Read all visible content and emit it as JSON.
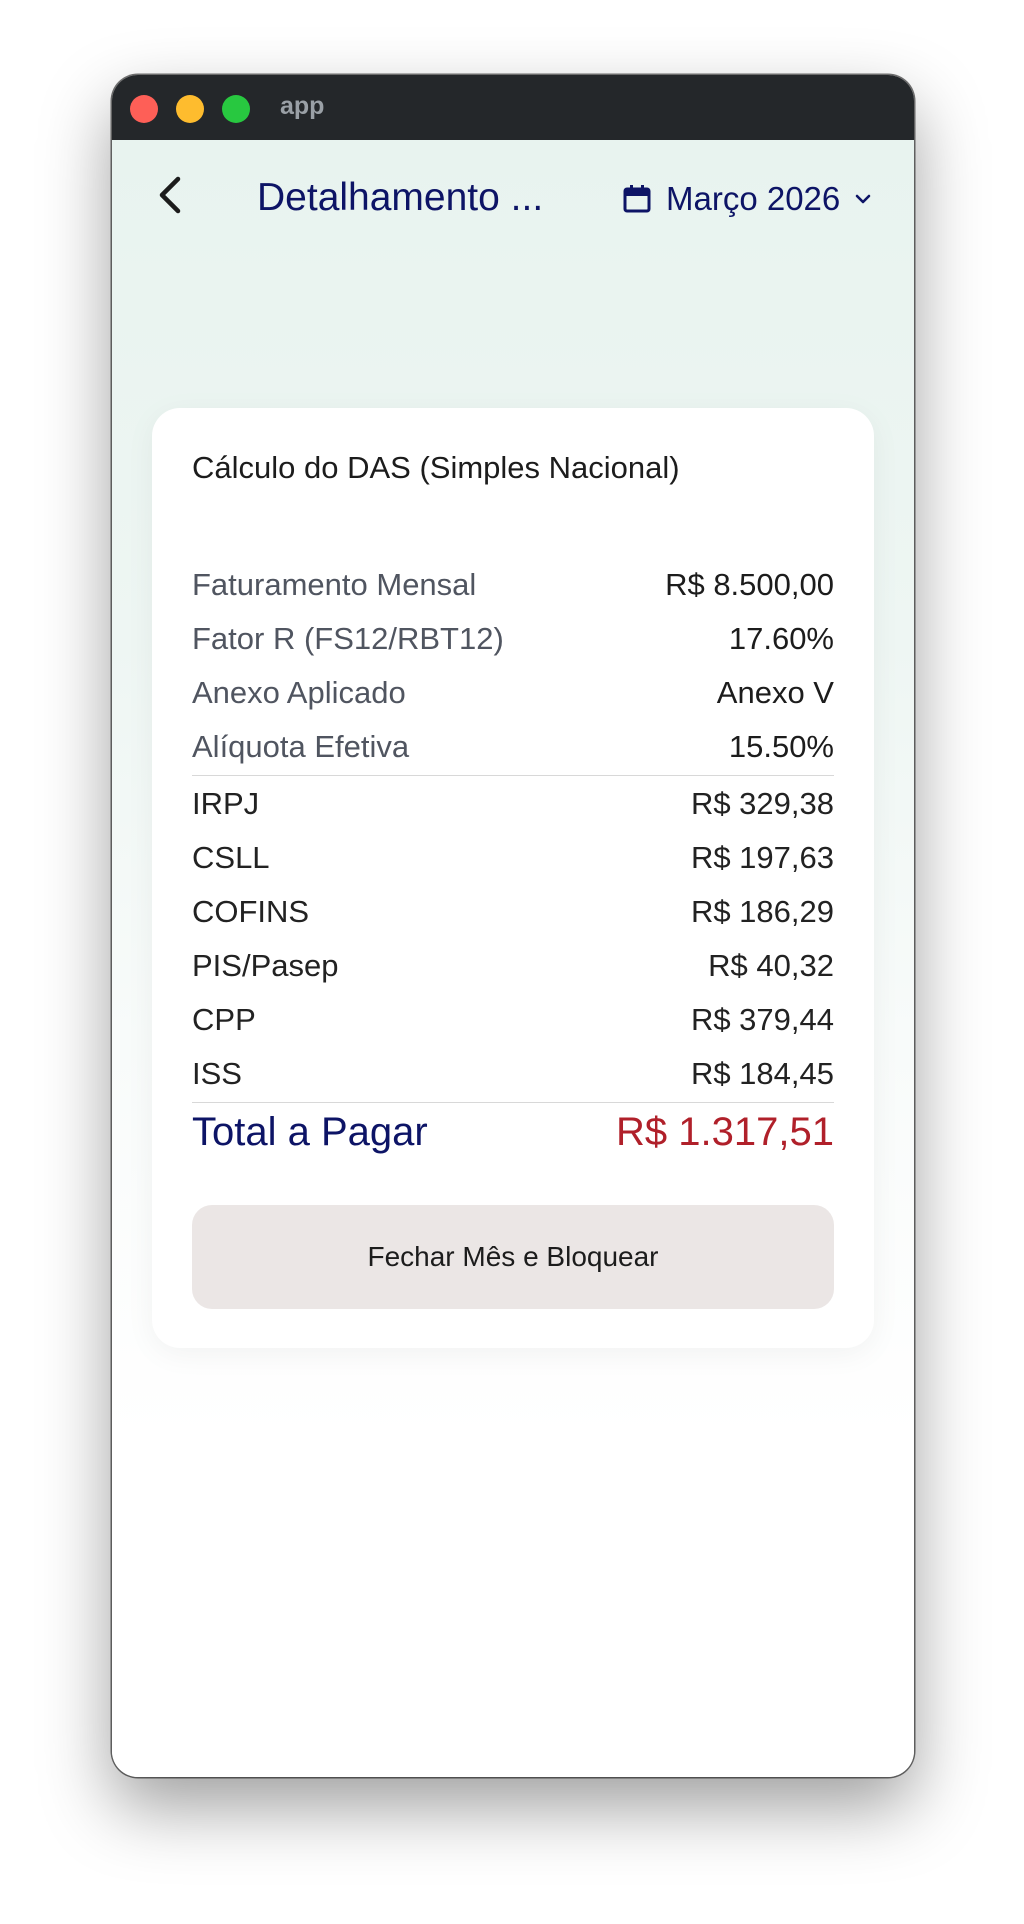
{
  "window": {
    "title": "app"
  },
  "header": {
    "title": "Detalhamento ...",
    "month": "Março 2026"
  },
  "card": {
    "title": "Cálculo do DAS (Simples Nacional)",
    "summary": [
      {
        "label": "Faturamento Mensal",
        "value": "R$ 8.500,00"
      },
      {
        "label": "Fator R (FS12/RBT12)",
        "value": "17.60%"
      },
      {
        "label": "Anexo Aplicado",
        "value": "Anexo V"
      },
      {
        "label": "Alíquota Efetiva",
        "value": "15.50%"
      }
    ],
    "taxes": [
      {
        "label": "IRPJ",
        "value": "R$ 329,38"
      },
      {
        "label": "CSLL",
        "value": "R$ 197,63"
      },
      {
        "label": "COFINS",
        "value": "R$ 186,29"
      },
      {
        "label": "PIS/Pasep",
        "value": "R$ 40,32"
      },
      {
        "label": "CPP",
        "value": "R$ 379,44"
      },
      {
        "label": "ISS",
        "value": "R$ 184,45"
      }
    ],
    "total": {
      "label": "Total a Pagar",
      "value": "R$ 1.317,51"
    },
    "button_label": "Fechar Mês e Bloquear"
  },
  "colors": {
    "accent": "#0d1466",
    "total_value": "#b0202a",
    "button_bg": "#ebe6e5"
  },
  "icons": {
    "back": "chevron-left-icon",
    "calendar": "calendar-icon",
    "dropdown": "chevron-down-icon"
  }
}
